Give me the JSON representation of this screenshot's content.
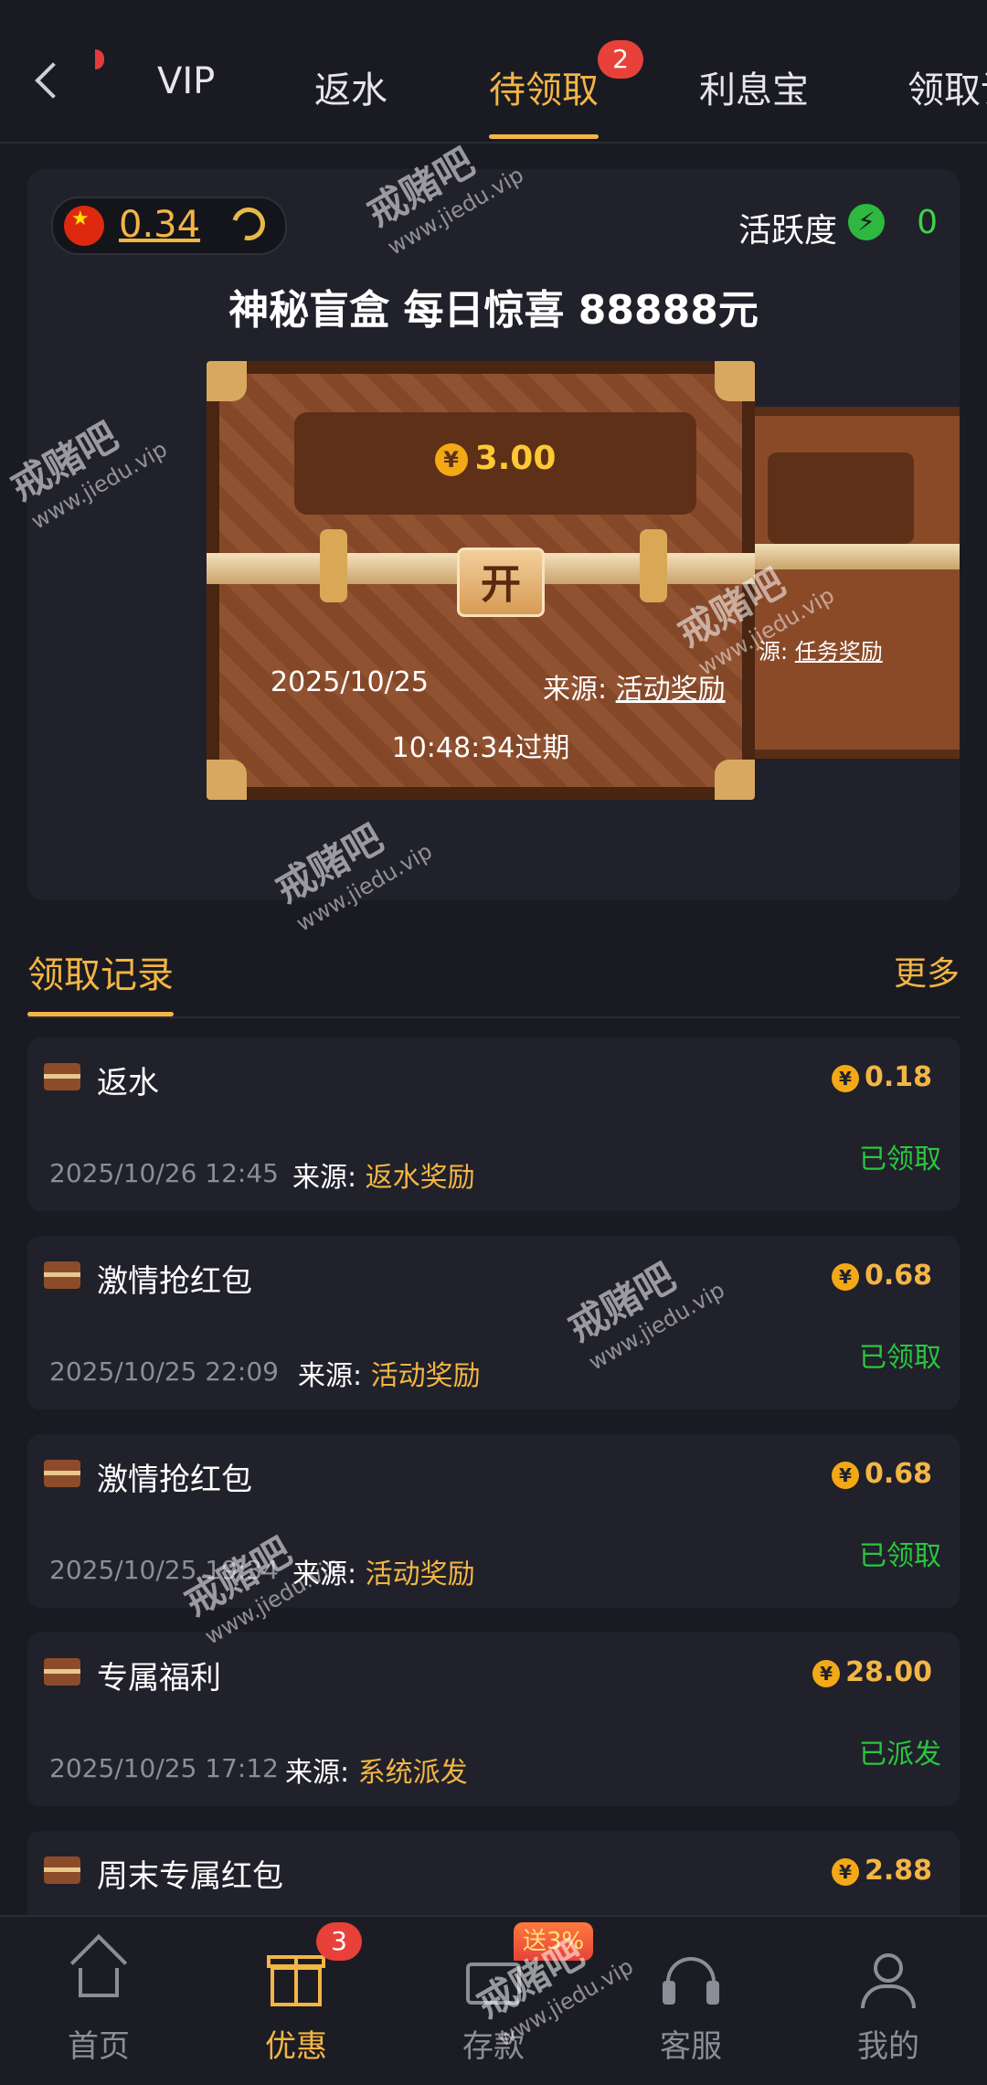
{
  "topnav": {
    "tabs": [
      {
        "label": "VIP"
      },
      {
        "label": "返水"
      },
      {
        "label": "待领取",
        "badge": "2"
      },
      {
        "label": "利息宝"
      },
      {
        "label": "领取记录"
      }
    ],
    "active_tab_index": 2
  },
  "blind_box": {
    "balance": "0.34",
    "activity_label": "活跃度",
    "activity_value": "0",
    "title": "神秘盲盒 每日惊喜 88888元",
    "chest": {
      "amount": "3.00",
      "open_label": "开",
      "date": "2025/10/25",
      "source_label": "来源:",
      "source_value": "活动奖励",
      "expire_text": "10:48:34过期"
    },
    "next_chest": {
      "source_label": "源:",
      "source_value": "任务奖励"
    }
  },
  "records": {
    "title": "领取记录",
    "more_label": "更多",
    "items": [
      {
        "title": "返水",
        "amount": "0.18",
        "date": "2025/10/26 12:45",
        "source_label": "来源:",
        "source_value": "返水奖励",
        "status": "已领取"
      },
      {
        "title": "激情抢红包",
        "amount": "0.68",
        "date": "2025/10/25 22:09",
        "source_label": "来源:",
        "source_value": "活动奖励",
        "status": "已领取"
      },
      {
        "title": "激情抢红包",
        "amount": "0.68",
        "date": "2025/10/25 19:34",
        "source_label": "来源:",
        "source_value": "活动奖励",
        "status": "已领取"
      },
      {
        "title": "专属福利",
        "amount": "28.00",
        "date": "2025/10/25 17:12",
        "source_label": "来源:",
        "source_value": "系统派发",
        "status": "已派发"
      },
      {
        "title": "周末专属红包",
        "amount": "2.88",
        "date": "",
        "source_label": "",
        "source_value": "",
        "status": ""
      }
    ]
  },
  "bottomnav": {
    "items": [
      {
        "label": "首页",
        "icon": "home-icon"
      },
      {
        "label": "优惠",
        "icon": "gift-icon",
        "badge": "3"
      },
      {
        "label": "存款",
        "icon": "wallet-icon",
        "promo": "送3%"
      },
      {
        "label": "客服",
        "icon": "headset-icon"
      },
      {
        "label": "我的",
        "icon": "user-icon"
      }
    ],
    "active_index": 1
  },
  "watermark": {
    "brand": "戒赌吧",
    "url": "www.jiedu.vip"
  },
  "colors": {
    "accent": "#f3b545",
    "success": "#2bc53f",
    "badge": "#e8413a",
    "background": "#1a1b22"
  }
}
